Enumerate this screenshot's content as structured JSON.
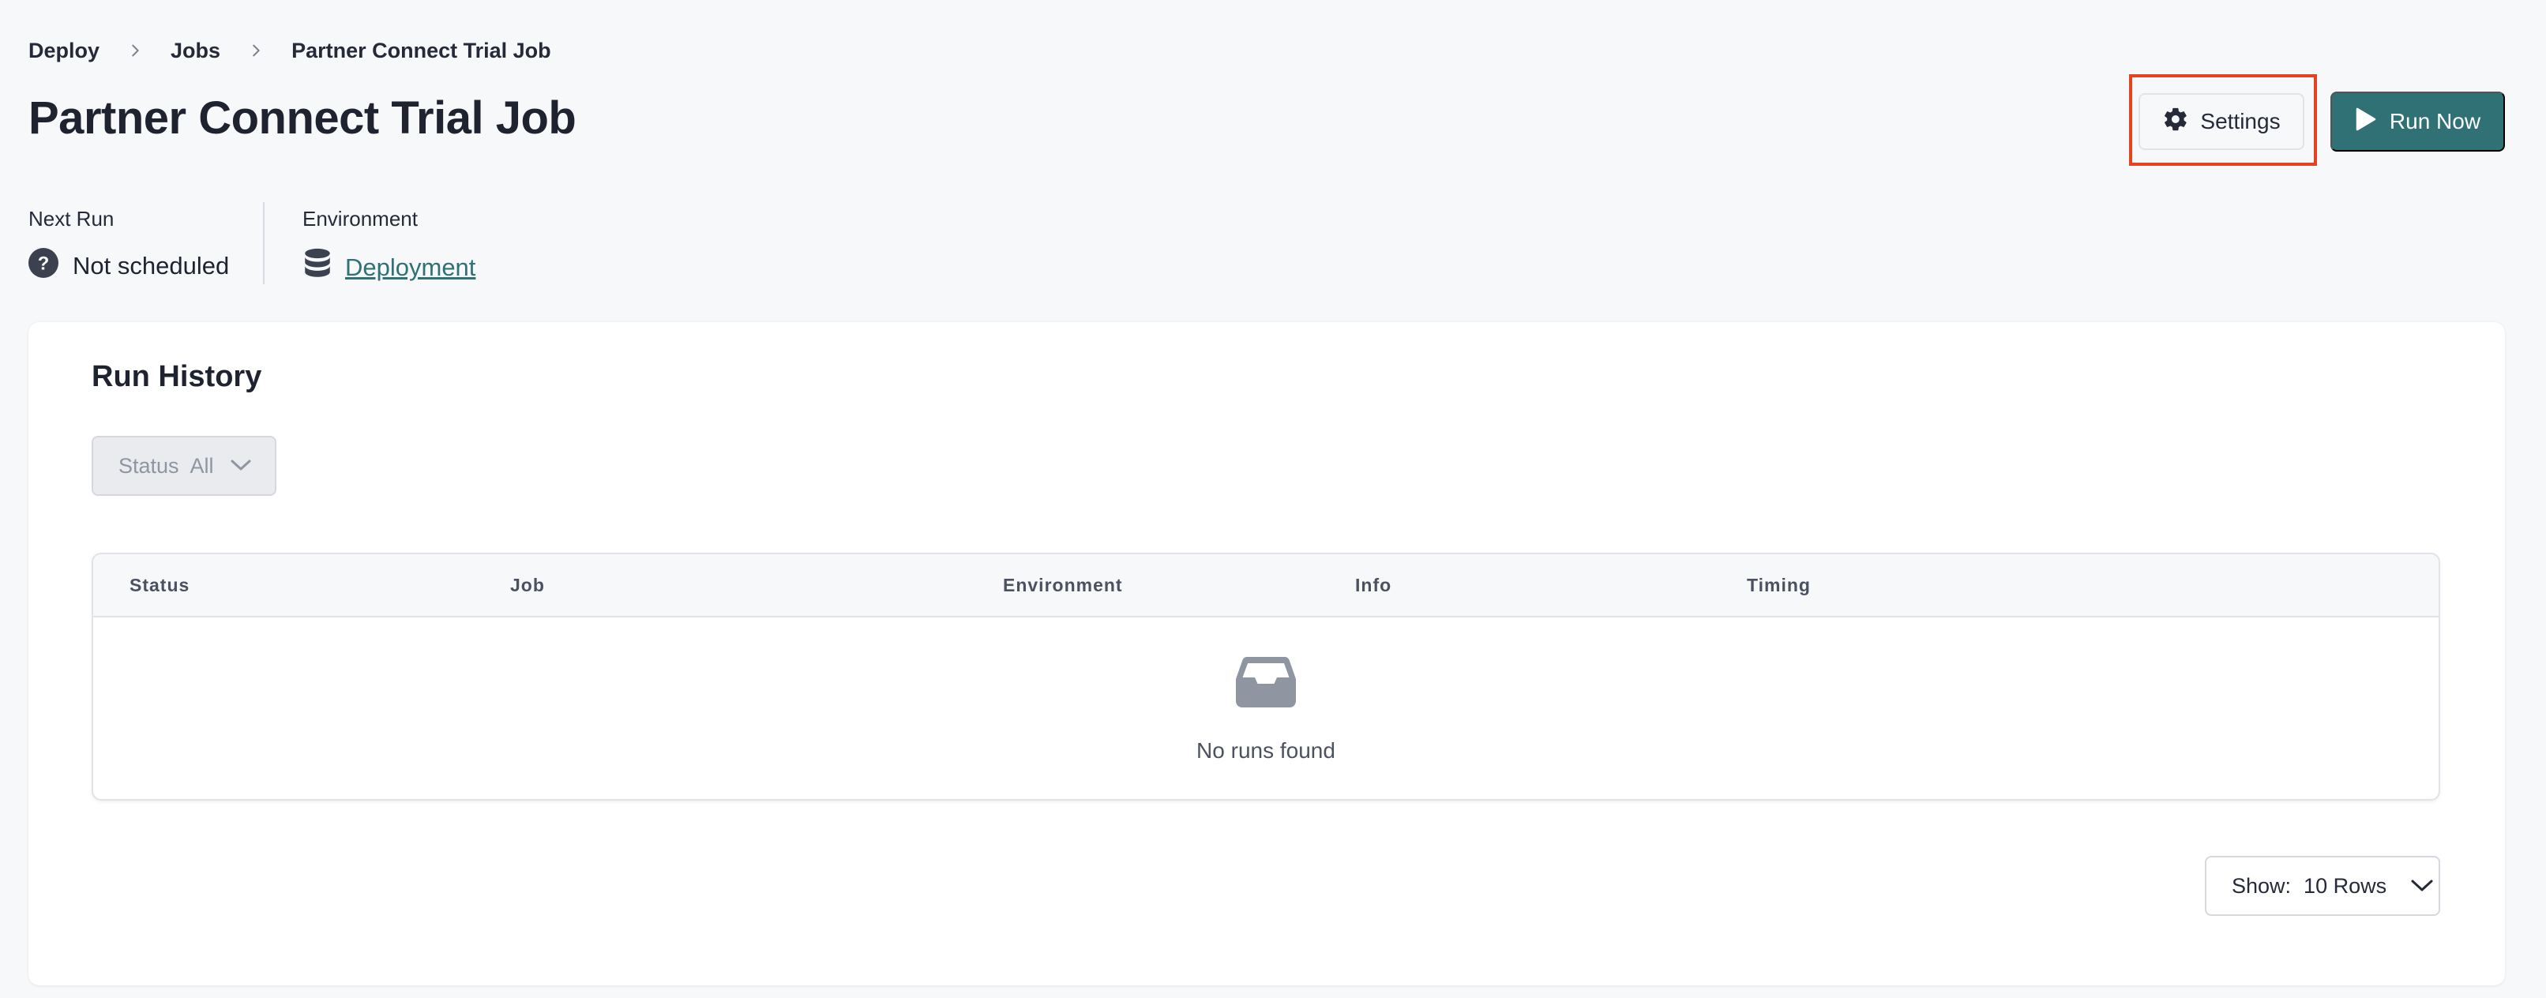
{
  "breadcrumb": {
    "items": [
      "Deploy",
      "Jobs",
      "Partner Connect Trial Job"
    ]
  },
  "page": {
    "title": "Partner Connect Trial Job"
  },
  "actions": {
    "settings_label": "Settings",
    "run_now_label": "Run Now"
  },
  "meta": {
    "next_run_label": "Next Run",
    "next_run_value": "Not scheduled",
    "environment_label": "Environment",
    "environment_value": "Deployment"
  },
  "run_history": {
    "title": "Run History",
    "filter": {
      "label": "Status",
      "value": "All"
    },
    "columns": [
      "Status",
      "Job",
      "Environment",
      "Info",
      "Timing"
    ],
    "empty_message": "No runs found",
    "pagination": {
      "label": "Show:",
      "value": "10 Rows"
    }
  },
  "icons": {
    "breadcrumb_separator": "chevron-right-icon",
    "settings": "gear-icon",
    "run_now": "play-icon",
    "next_run": "question-circle-icon",
    "environment": "database-icon",
    "empty": "inbox-icon",
    "dropdown": "chevron-down-icon"
  },
  "colors": {
    "accent": "#2f7175",
    "highlight": "#e5421f",
    "background": "#f7f8fa"
  }
}
